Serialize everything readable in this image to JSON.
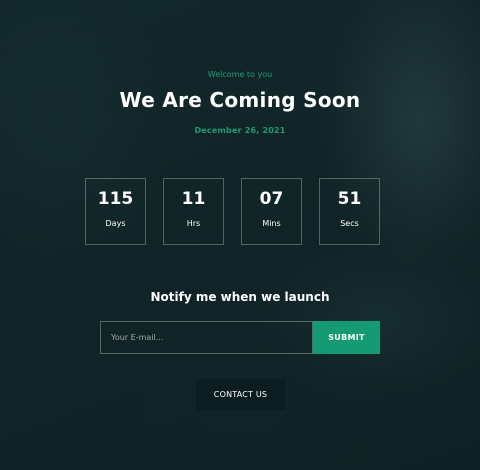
{
  "header": {
    "welcome": "Welcome to you",
    "title": "We Are Coming Soon",
    "date": "December 26, 2021"
  },
  "countdown": [
    {
      "value": "115",
      "label": "Days"
    },
    {
      "value": "11",
      "label": "Hrs"
    },
    {
      "value": "07",
      "label": "Mins"
    },
    {
      "value": "51",
      "label": "Secs"
    }
  ],
  "notify": {
    "heading": "Notify me when we launch",
    "email_placeholder": "Your E-mail...",
    "email_value": "",
    "submit_label": "SUBMIT"
  },
  "contact": {
    "label": "CONTACT US"
  },
  "colors": {
    "accent": "#169a73",
    "dark_button": "#0b1d21",
    "background": "#17292c"
  }
}
